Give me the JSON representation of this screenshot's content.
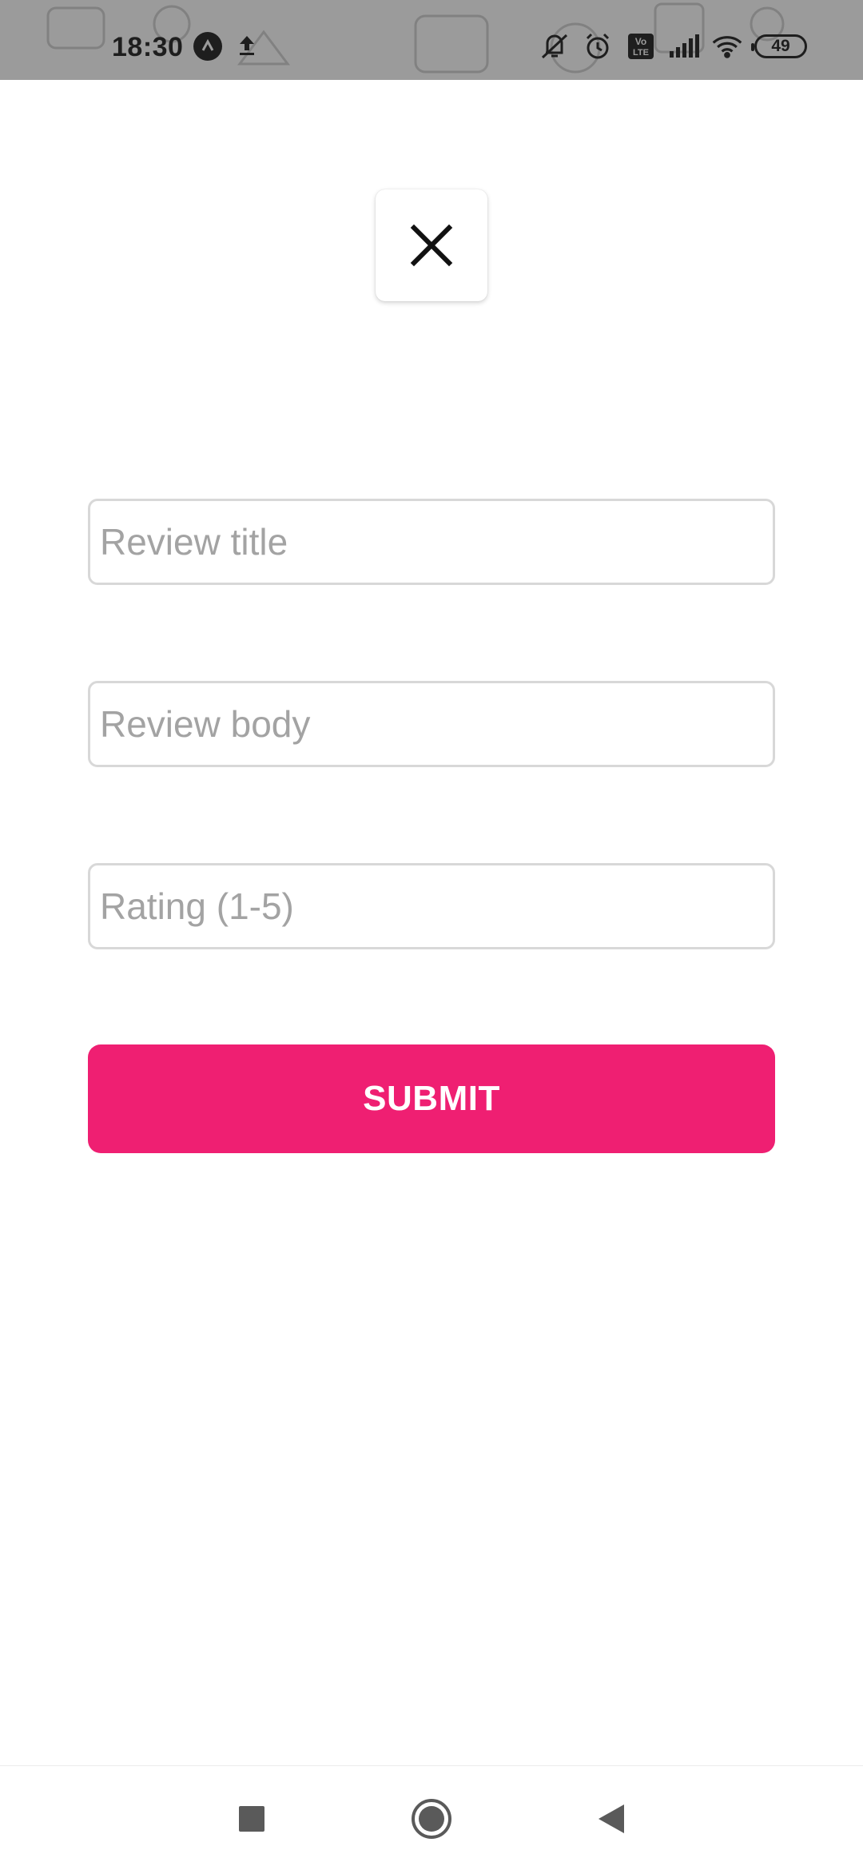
{
  "status_bar": {
    "time": "18:30",
    "battery_level": "49",
    "left_icons": [
      "app-circle-icon",
      "upload-icon"
    ],
    "right_icons": [
      "vibrate-off-icon",
      "alarm-icon",
      "volte-icon",
      "signal-icon",
      "wifi-icon",
      "battery-icon"
    ],
    "volte_label": "Vo LTE"
  },
  "form": {
    "close_icon": "close-icon",
    "fields": [
      {
        "placeholder": "Review title",
        "value": ""
      },
      {
        "placeholder": "Review body",
        "value": ""
      },
      {
        "placeholder": "Rating (1-5)",
        "value": ""
      }
    ],
    "submit_label": "SUBMIT"
  },
  "nav_bar": {
    "buttons": [
      "recents-square-icon",
      "home-circle-icon",
      "back-triangle-icon"
    ]
  },
  "colors": {
    "accent": "#ef1f72",
    "status_bar": "#9b9b9b",
    "field_border": "#d8d8d8",
    "placeholder": "#a3a3a3"
  }
}
